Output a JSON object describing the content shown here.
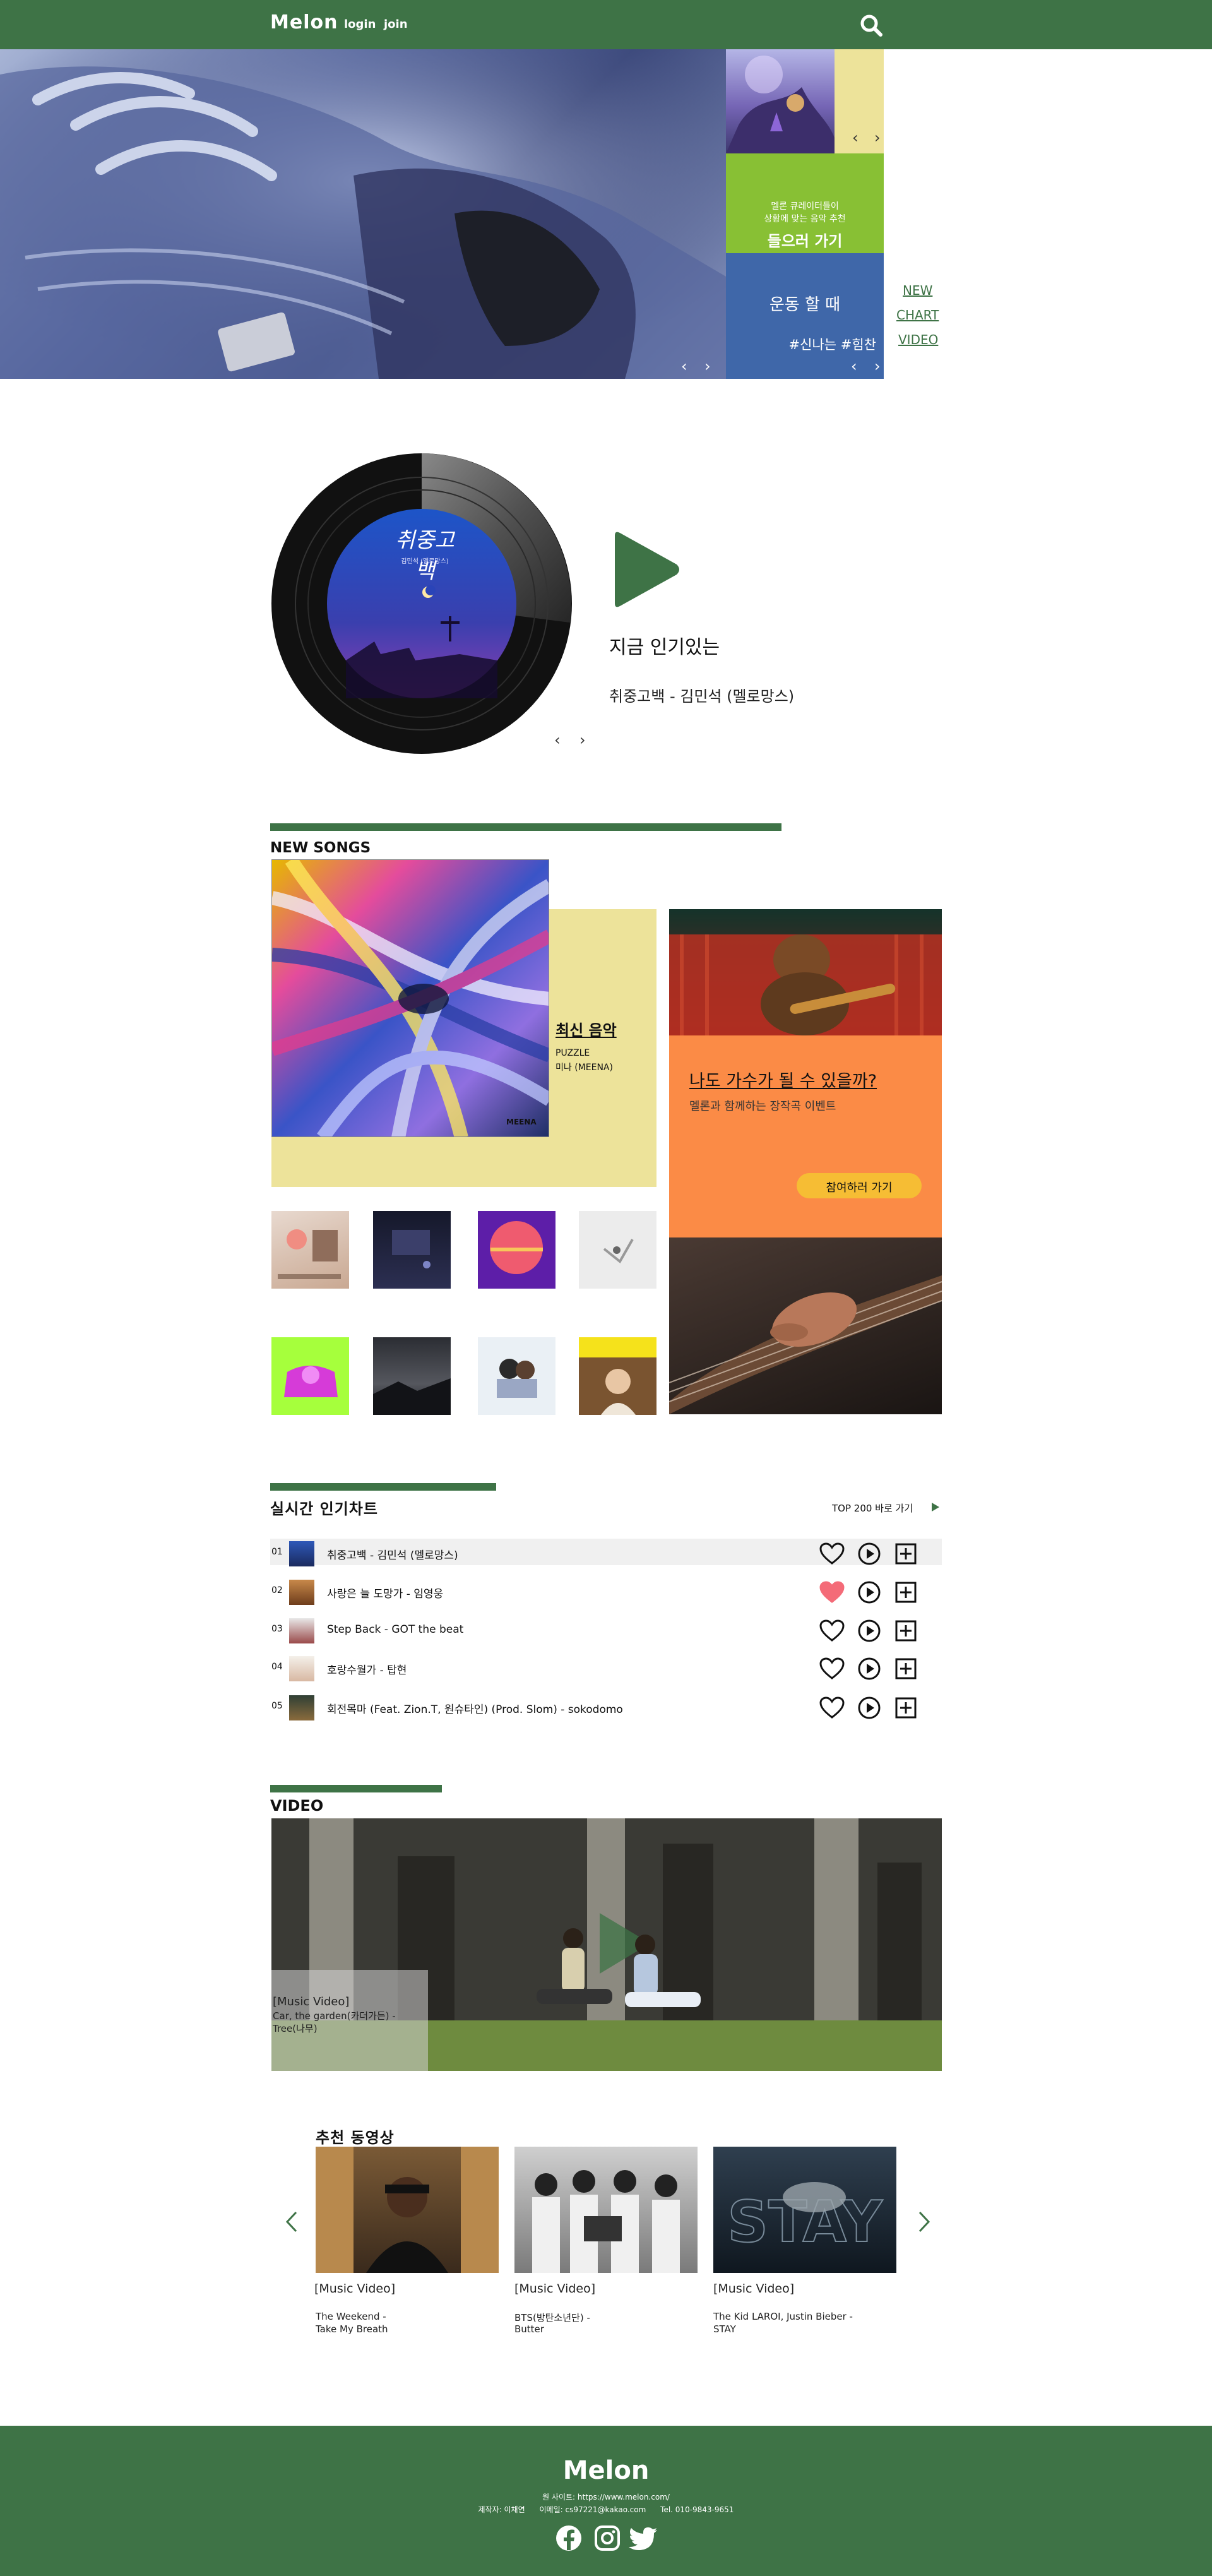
{
  "header": {
    "logo": "Melon",
    "login": "login",
    "join": "join"
  },
  "hero": {
    "promo_line1": "멜론 큐레이터들이",
    "promo_line2": "상황에 맞는 음악 추천",
    "promo_cta": "들으러 가기",
    "workout_title": "운동 할 때",
    "workout_tags": "#신나는 #힘찬",
    "side_links": [
      "NEW",
      "CHART",
      "VIDEO"
    ]
  },
  "now_playing": {
    "album_title": "취중고백",
    "album_sub": "김민석 (멜로망스)",
    "heading": "지금 인기있는",
    "track": "취중고백 - 김민석 (멜로망스)"
  },
  "new_songs": {
    "section_title": "NEW SONGS",
    "feature_label": "최신 음악",
    "feature_title": "PUZZLE",
    "feature_artist": "미나 (MEENA)",
    "cover_artist": "MEENA",
    "event_title": "나도 가수가 될 수 있을까?",
    "event_sub": "멜론과 함께하는 장작곡 이벤트",
    "event_cta": "참여하러 가기"
  },
  "chart": {
    "title": "실시간 인기차트",
    "top200": "TOP 200 바로 가기",
    "rows": [
      {
        "rank": "01",
        "text": "취중고백 - 김민석 (멜로망스)",
        "liked": false
      },
      {
        "rank": "02",
        "text": "사랑은 늘 도망가 - 임영웅",
        "liked": true
      },
      {
        "rank": "03",
        "text": "Step Back - GOT the beat",
        "liked": false
      },
      {
        "rank": "04",
        "text": "호랑수월가 - 탑현",
        "liked": false
      },
      {
        "rank": "05",
        "text": "회전목마 (Feat. Zion.T, 원슈타인) (Prod. Slom) - sokodomo",
        "liked": false
      }
    ]
  },
  "video": {
    "section_title": "VIDEO",
    "caption_line1": "[Music Video]",
    "caption_line2": "Car, the garden(카더가든) -",
    "caption_line3": "Tree(나무)"
  },
  "recommended": {
    "title": "추천 동영상",
    "items": [
      {
        "tag": "[Music Video]",
        "line1": "The Weekend -",
        "line2": "Take My Breath"
      },
      {
        "tag": "[Music Video]",
        "line1": "BTS(방탄소년단) -",
        "line2": "Butter"
      },
      {
        "tag": "[Music Video]",
        "line1": "The Kid LAROI, Justin Bieber -",
        "line2": "STAY"
      }
    ]
  },
  "footer": {
    "logo": "Melon",
    "site": "원 사이트: https://www.melon.com/",
    "credits": "제작자: 이채연      이메일: cs97221@kakao.com      Tel. 010-9843-9651"
  },
  "colors": {
    "brand_green": "#3e7346",
    "chart_row_bg": "#f0f0f0",
    "feature_yellow": "#ede39a",
    "event_orange": "#fb8b46",
    "heart_pink": "#f46b78"
  }
}
